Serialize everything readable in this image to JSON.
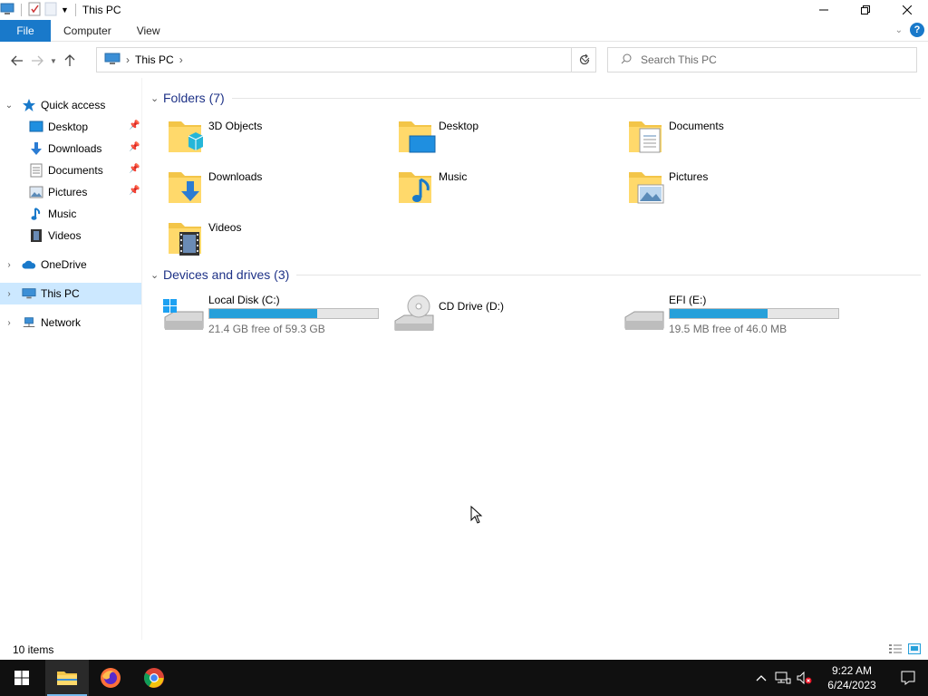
{
  "window": {
    "title": "This PC"
  },
  "ribbon": {
    "file_tab": "File",
    "tabs": [
      "Computer",
      "View"
    ]
  },
  "address": {
    "location": "This PC",
    "search_placeholder": "Search This PC"
  },
  "sidebar": {
    "items": [
      {
        "label": "Quick access",
        "icon": "star-icon"
      },
      {
        "label": "Desktop",
        "icon": "desktop-icon",
        "pinned": true
      },
      {
        "label": "Downloads",
        "icon": "download-arrow-icon",
        "pinned": true
      },
      {
        "label": "Documents",
        "icon": "document-icon",
        "pinned": true
      },
      {
        "label": "Pictures",
        "icon": "pictures-icon",
        "pinned": true
      },
      {
        "label": "Music",
        "icon": "music-note-icon"
      },
      {
        "label": "Videos",
        "icon": "film-icon"
      },
      {
        "label": "OneDrive",
        "icon": "cloud-icon"
      },
      {
        "label": "This PC",
        "icon": "computer-icon",
        "selected": true
      },
      {
        "label": "Network",
        "icon": "network-icon"
      }
    ]
  },
  "folders": {
    "header": "Folders (7)",
    "items": [
      "3D Objects",
      "Desktop",
      "Documents",
      "Downloads",
      "Music",
      "Pictures",
      "Videos"
    ]
  },
  "drives": {
    "header": "Devices and drives (3)",
    "items": [
      {
        "name": "Local Disk (C:)",
        "free": "21.4 GB free of 59.3 GB",
        "used_fraction": 0.64
      },
      {
        "name": "CD Drive (D:)",
        "free": "",
        "used_fraction": null
      },
      {
        "name": "EFI (E:)",
        "free": "19.5 MB free of 46.0 MB",
        "used_fraction": 0.58
      }
    ]
  },
  "status": {
    "count": "10 items"
  },
  "taskbar": {
    "time": "9:22 AM",
    "date": "6/24/2023"
  },
  "colors": {
    "accent": "#1979ca",
    "selection": "#cce8ff",
    "drive_fill": "#26a0da",
    "group_header": "#1e3287"
  }
}
